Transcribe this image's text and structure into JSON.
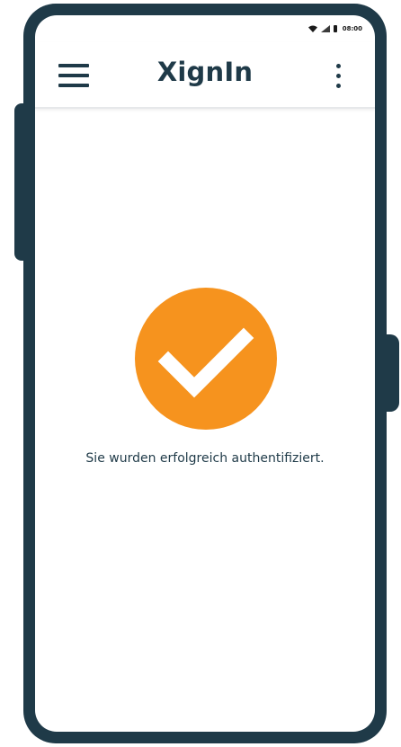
{
  "status_bar": {
    "time": "08:00",
    "icons": [
      "wifi-icon",
      "signal-icon",
      "battery-icon"
    ]
  },
  "app_bar": {
    "title": "XignIn",
    "left_icon": "hamburger-menu-icon",
    "right_icon": "more-vert-icon"
  },
  "content": {
    "status_icon": "checkmark-icon",
    "message": "Sie wurden erfolgreich authentifiziert."
  },
  "colors": {
    "primary_dark": "#1f3a48",
    "accent_orange": "#f6931e",
    "background": "#ffffff"
  }
}
